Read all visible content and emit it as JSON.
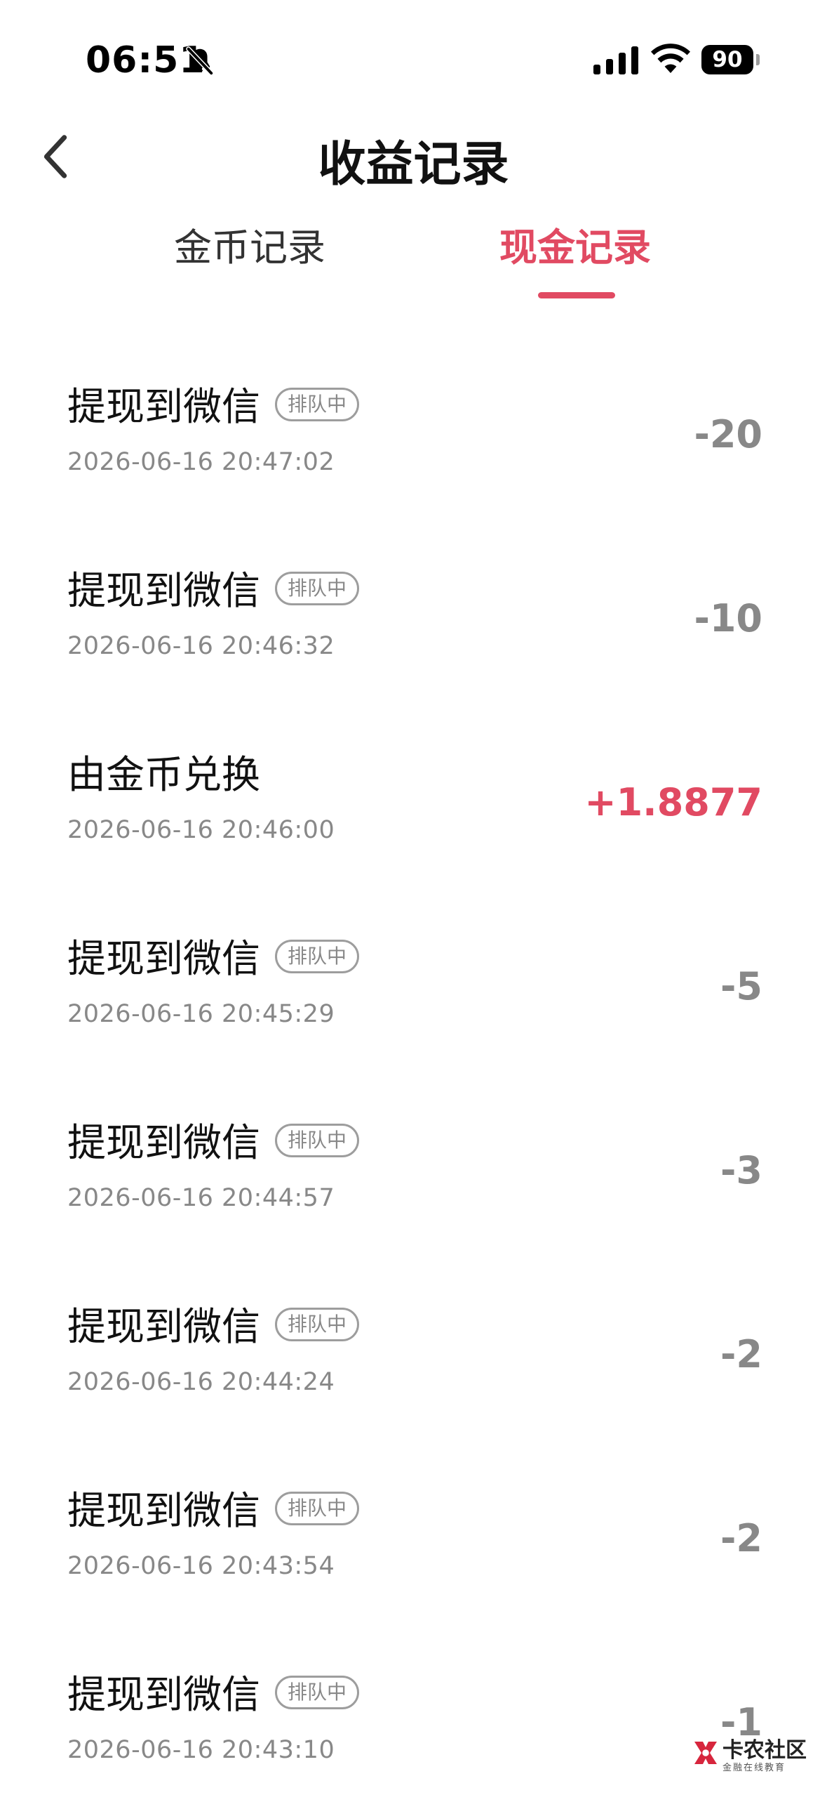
{
  "status_bar": {
    "time": "06:51",
    "battery": "90",
    "icons": [
      "bell-slash-icon",
      "cellular-signal-icon",
      "wifi-icon",
      "battery-icon"
    ]
  },
  "nav": {
    "back_icon": "chevron-left-icon",
    "title": "收益记录"
  },
  "tabs": [
    {
      "label": "金币记录",
      "active": false
    },
    {
      "label": "现金记录",
      "active": true
    }
  ],
  "colors": {
    "accent": "#E14A62",
    "amount_negative": "#888888",
    "secondary_text": "#888888"
  },
  "records": [
    {
      "title": "提现到微信",
      "badge": "排队中",
      "time": "2026-06-16 20:47:02",
      "amount": "-20"
    },
    {
      "title": "提现到微信",
      "badge": "排队中",
      "time": "2026-06-16 20:46:32",
      "amount": "-10"
    },
    {
      "title": "由金币兑换",
      "badge": "",
      "time": "2026-06-16 20:46:00",
      "amount": "+1.8877"
    },
    {
      "title": "提现到微信",
      "badge": "排队中",
      "time": "2026-06-16 20:45:29",
      "amount": "-5"
    },
    {
      "title": "提现到微信",
      "badge": "排队中",
      "time": "2026-06-16 20:44:57",
      "amount": "-3"
    },
    {
      "title": "提现到微信",
      "badge": "排队中",
      "time": "2026-06-16 20:44:24",
      "amount": "-2"
    },
    {
      "title": "提现到微信",
      "badge": "排队中",
      "time": "2026-06-16 20:43:54",
      "amount": "-2"
    },
    {
      "title": "提现到微信",
      "badge": "排队中",
      "time": "2026-06-16 20:43:10",
      "amount": "-1"
    }
  ],
  "watermark": {
    "name": "卡农社区",
    "tagline": "金融在线教育"
  }
}
